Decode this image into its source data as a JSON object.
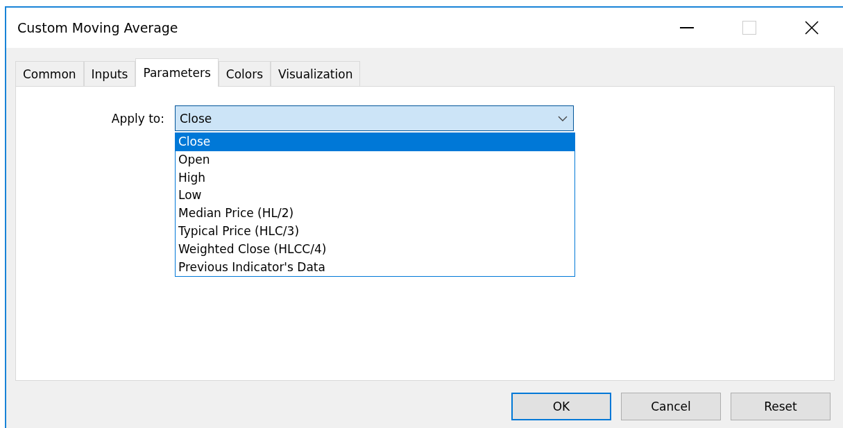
{
  "window": {
    "title": "Custom Moving Average"
  },
  "tabs": [
    {
      "label": "Common",
      "selected": false
    },
    {
      "label": "Inputs",
      "selected": false
    },
    {
      "label": "Parameters",
      "selected": true
    },
    {
      "label": "Colors",
      "selected": false
    },
    {
      "label": "Visualization",
      "selected": false
    }
  ],
  "apply_to": {
    "label": "Apply to:",
    "value": "Close",
    "expanded": true,
    "options": [
      {
        "label": "Close",
        "selected": true
      },
      {
        "label": "Open",
        "selected": false
      },
      {
        "label": "High",
        "selected": false
      },
      {
        "label": "Low",
        "selected": false
      },
      {
        "label": "Median Price (HL/2)",
        "selected": false
      },
      {
        "label": "Typical Price (HLC/3)",
        "selected": false
      },
      {
        "label": "Weighted Close (HLCC/4)",
        "selected": false
      },
      {
        "label": "Previous Indicator's Data",
        "selected": false
      }
    ]
  },
  "buttons": [
    {
      "label": "OK",
      "default": true
    },
    {
      "label": "Cancel",
      "default": false
    },
    {
      "label": "Reset",
      "default": false
    }
  ]
}
